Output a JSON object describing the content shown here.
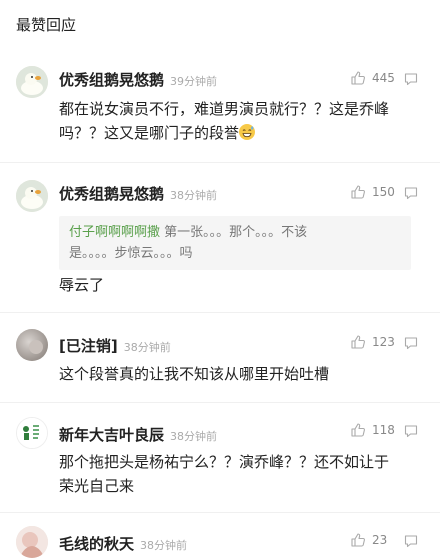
{
  "section_title": "最赞回应",
  "comments": [
    {
      "username": "优秀组鹅晃悠鹅",
      "time": "39分钟前",
      "likes": "445",
      "text_lines": [
        "都在说女演员不行，难道男演员就行？？这是乔峰",
        "吗？？这又是哪门子的段誉"
      ],
      "emoji": "grinning-sweat-emoji"
    },
    {
      "username": "优秀组鹅晃悠鹅",
      "time": "38分钟前",
      "likes": "150",
      "quote_name": "付子啊啊啊啊撒",
      "quote_lines": [
        "第一张。。。那个。。。不该",
        "是。。。。步惊云。。。吗"
      ],
      "text_lines": [
        "辱云了"
      ]
    },
    {
      "username": "[已注销]",
      "time": "38分钟前",
      "likes": "123",
      "text_lines": [
        "这个段誉真的让我不知该从哪里开始吐槽"
      ]
    },
    {
      "username": "新年大吉叶良辰",
      "time": "38分钟前",
      "likes": "118",
      "text_lines": [
        "那个拖把头是杨祐宁么？？演乔峰？？还不如让于",
        "荣光自己来"
      ]
    },
    {
      "username": "毛线的秋天",
      "time": "38分钟前",
      "likes": "23"
    }
  ],
  "icons": {
    "like": "thumbs-up-icon",
    "reply": "reply-bubble-icon"
  },
  "colors": {
    "quote_name": "#5aa04c",
    "meta": "#aaaaaa"
  }
}
